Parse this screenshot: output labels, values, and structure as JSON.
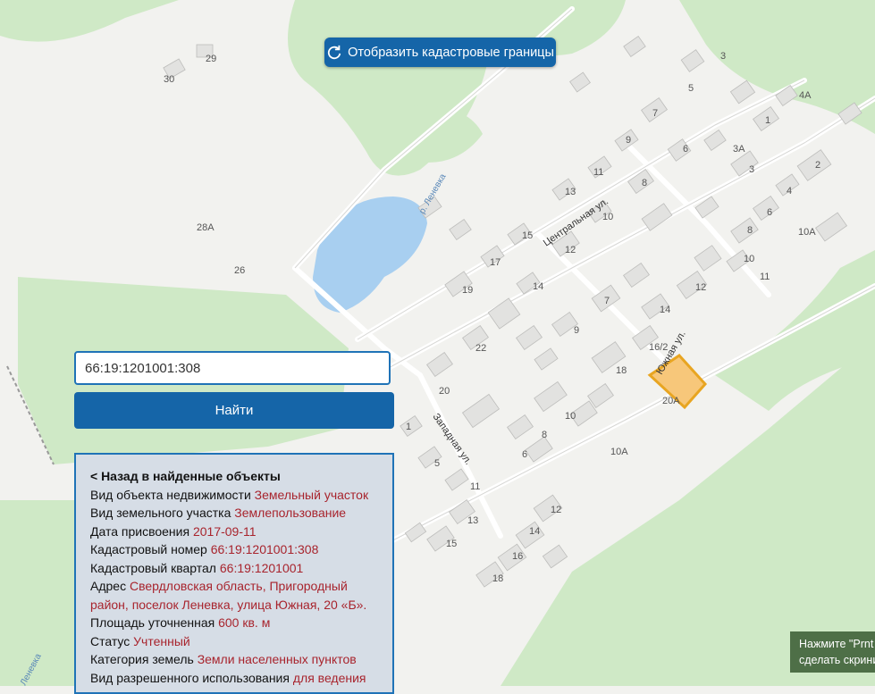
{
  "map": {
    "cadastral_button": "Отобразить кадастровые границы",
    "river_label": "р. Леневка",
    "river_label_2": "Леневка",
    "streets": {
      "central": "Центральная ул.",
      "west": "Западная ул.",
      "south": "Южная ул."
    },
    "house_numbers": [
      "30",
      "29",
      "28А",
      "26",
      "3",
      "4А",
      "5",
      "1",
      "7",
      "9",
      "3А",
      "6",
      "2",
      "11",
      "3",
      "8",
      "13",
      "4",
      "10",
      "6",
      "10А",
      "15",
      "12",
      "8",
      "17",
      "10",
      "19",
      "14",
      "12",
      "11",
      "7",
      "14",
      "16/2",
      "18",
      "22",
      "9",
      "20",
      "10",
      "8",
      "20А",
      "10А",
      "6",
      "1",
      "5",
      "11",
      "13",
      "15",
      "12",
      "14",
      "16",
      "18"
    ],
    "selected_parcel_color": "#e8a521",
    "selected_parcel_fill": "#f7c77a"
  },
  "search": {
    "value": "66:19:1201001:308",
    "button": "Найти"
  },
  "details": {
    "back": "< Назад в найденные объекты",
    "rows": [
      {
        "label": "Вид объекта недвижимости",
        "value": "Земельный участок"
      },
      {
        "label": "Вид земельного участка",
        "value": "Землепользование"
      },
      {
        "label": "Дата присвоения",
        "value": "2017-09-11"
      },
      {
        "label": "Кадастровый номер",
        "value": "66:19:1201001:308"
      },
      {
        "label": "Кадастровый квартал",
        "value": "66:19:1201001"
      },
      {
        "label": "Адрес",
        "value": "Свердловская область, Пригородный район, поселок Леневка, улица Южная, 20 «Б»."
      },
      {
        "label": "Площадь уточненная",
        "value": "600 кв. м"
      },
      {
        "label": "Статус",
        "value": "Учтенный"
      },
      {
        "label": "Категория земель",
        "value": "Земли населенных пунктов"
      },
      {
        "label": "Вид разрешенного использования",
        "value": "для ведения"
      }
    ]
  },
  "overlay": {
    "prnt_line1": "Нажмите \"Prnt",
    "prnt_line2": "сделать скрини"
  }
}
